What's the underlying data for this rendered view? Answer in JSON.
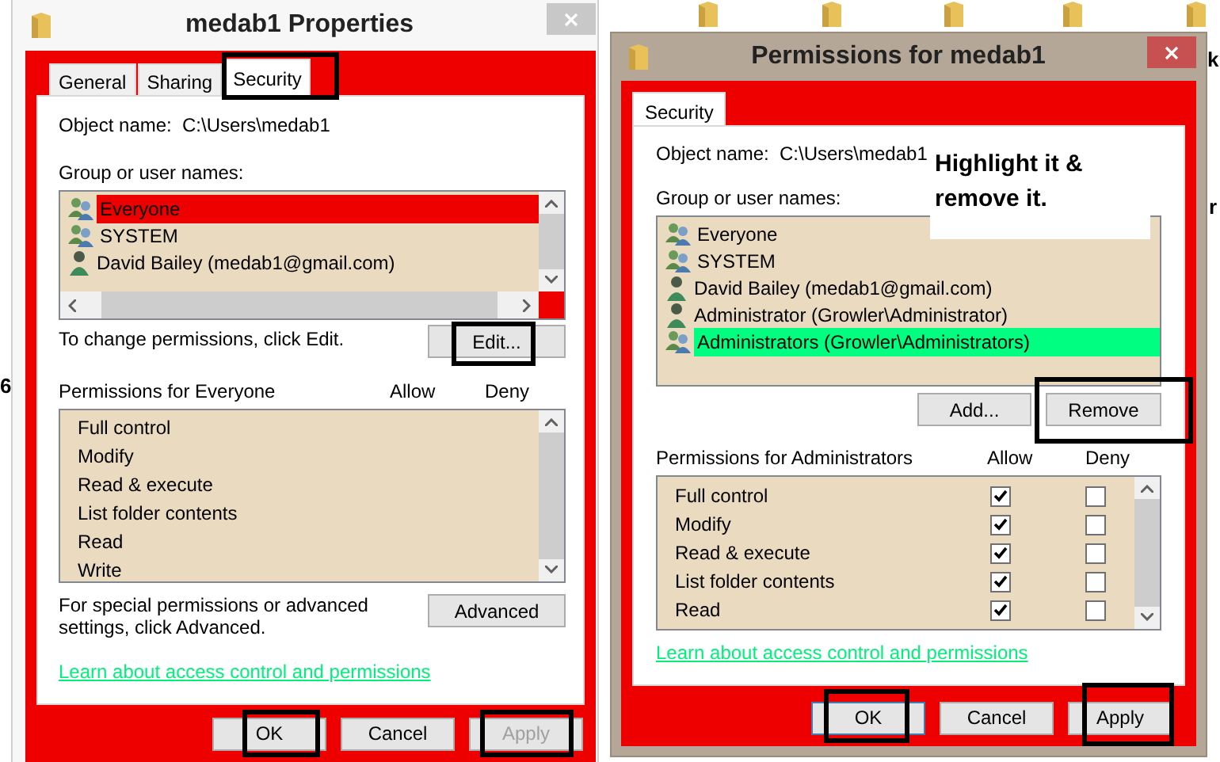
{
  "desktop_labels": [
    {
      "text": "6"
    },
    {
      "text": "k"
    },
    {
      "text": "r"
    }
  ],
  "properties_dialog": {
    "title": "medab1 Properties",
    "tabs": [
      {
        "label": "General",
        "selected": false,
        "annotated": false
      },
      {
        "label": "Sharing",
        "selected": false,
        "annotated": false
      },
      {
        "label": "Security",
        "selected": true,
        "annotated": true
      }
    ],
    "object_name_label": "Object name:",
    "object_name": "C:\\Users\\medab1",
    "groups_label": "Group or user names:",
    "groups": [
      {
        "name": "Everyone",
        "kind": "group",
        "selected": true
      },
      {
        "name": "SYSTEM",
        "kind": "group",
        "selected": false
      },
      {
        "name": "David Bailey (medab1@gmail.com)",
        "kind": "user",
        "selected": false
      }
    ],
    "edit_hint": "To change permissions, click Edit.",
    "edit_button": {
      "label": "Edit...",
      "annotated": true
    },
    "permissions_label": "Permissions for Everyone",
    "allow_header": "Allow",
    "deny_header": "Deny",
    "permissions": [
      {
        "name": "Full control"
      },
      {
        "name": "Modify"
      },
      {
        "name": "Read & execute"
      },
      {
        "name": "List folder contents"
      },
      {
        "name": "Read"
      },
      {
        "name": "Write"
      }
    ],
    "advanced_hint": "For special permissions or advanced settings, click Advanced.",
    "advanced_button": {
      "label": "Advanced",
      "annotated": false
    },
    "link": "Learn about access control and permissions",
    "buttons": [
      {
        "label": "OK",
        "disabled": false,
        "annotated": true
      },
      {
        "label": "Cancel",
        "disabled": false,
        "annotated": false
      },
      {
        "label": "Apply",
        "disabled": true,
        "annotated": true
      }
    ]
  },
  "permissions_dialog": {
    "title": "Permissions for medab1",
    "tabs": [
      {
        "label": "Security",
        "selected": true
      }
    ],
    "object_name_label": "Object name:",
    "object_name": "C:\\Users\\medab1",
    "groups_label": "Group or user names:",
    "groups": [
      {
        "name": "Everyone",
        "kind": "group",
        "selected": false
      },
      {
        "name": "SYSTEM",
        "kind": "group",
        "selected": false
      },
      {
        "name": "David Bailey (medab1@gmail.com)",
        "kind": "user",
        "selected": false
      },
      {
        "name": "Administrator (Growler\\Administrator)",
        "kind": "user",
        "selected": false
      },
      {
        "name": "Administrators (Growler\\Administrators)",
        "kind": "group",
        "selected": true
      }
    ],
    "add_button": {
      "label": "Add...",
      "annotated": false
    },
    "remove_button": {
      "label": "Remove",
      "annotated": true
    },
    "permissions_label": "Permissions for Administrators",
    "allow_header": "Allow",
    "deny_header": "Deny",
    "permissions": [
      {
        "name": "Full control",
        "allow": true,
        "deny": false
      },
      {
        "name": "Modify",
        "allow": true,
        "deny": false
      },
      {
        "name": "Read & execute",
        "allow": true,
        "deny": false
      },
      {
        "name": "List folder contents",
        "allow": true,
        "deny": false
      },
      {
        "name": "Read",
        "allow": true,
        "deny": false
      }
    ],
    "link": "Learn about access control and permissions",
    "buttons": [
      {
        "label": "OK",
        "disabled": false,
        "annotated": true
      },
      {
        "label": "Cancel",
        "disabled": false,
        "annotated": false
      },
      {
        "label": "Apply",
        "disabled": false,
        "annotated": true
      }
    ]
  },
  "annotation": {
    "text": "Highlight it & remove it."
  }
}
